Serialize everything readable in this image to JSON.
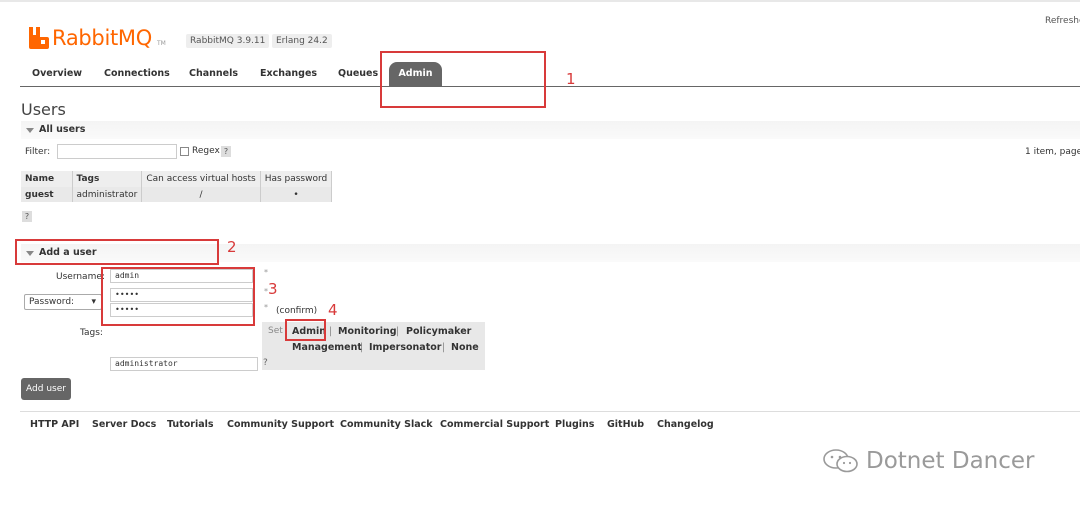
{
  "header": {
    "logo_text": "RabbitMQ",
    "logo_tm": "TM",
    "version": "RabbitMQ 3.9.11",
    "erlang": "Erlang 24.2",
    "refresh": "Refreshe"
  },
  "tabs": [
    "Overview",
    "Connections",
    "Channels",
    "Exchanges",
    "Queues",
    "Admin"
  ],
  "page_title": "Users",
  "all_users": {
    "label": "All users",
    "filter_label": "Filter:",
    "regex_label": "Regex",
    "help": "?",
    "pager": "1 item, page",
    "table": {
      "headers": [
        "Name",
        "Tags",
        "Can access virtual hosts",
        "Has password"
      ],
      "rows": [
        {
          "name": "guest",
          "tags": "administrator",
          "vhosts": "/",
          "has_password": "•"
        }
      ]
    }
  },
  "add_user": {
    "label": "Add a user",
    "username_label": "Username:",
    "username_value": "admin",
    "password_select": "Password:",
    "password_value": "•••••",
    "confirm_value": "•••••",
    "confirm_label": "(confirm)",
    "required_star": "*",
    "tags_label": "Tags:",
    "tags_value": "administrator",
    "set_label": "Set",
    "tag_options": [
      "Admin",
      "Monitoring",
      "Policymaker",
      "Management",
      "Impersonator",
      "None"
    ],
    "separator": "|",
    "submit": "Add user"
  },
  "footer": [
    "HTTP API",
    "Server Docs",
    "Tutorials",
    "Community Support",
    "Community Slack",
    "Commercial Support",
    "Plugins",
    "GitHub",
    "Changelog"
  ],
  "annotations": [
    "1",
    "2",
    "3",
    "4"
  ],
  "watermark": "Dotnet Dancer",
  "colors": {
    "brand": "#ff6600",
    "annotation": "#d83a3a",
    "active_tab": "#666666"
  }
}
